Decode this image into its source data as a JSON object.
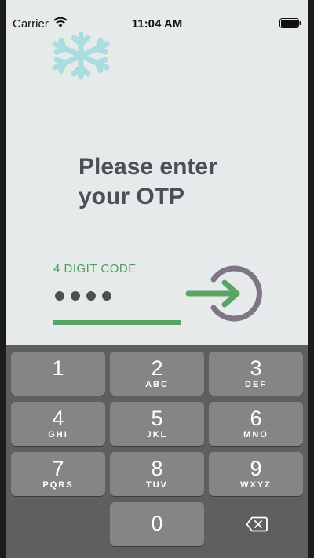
{
  "status_bar": {
    "carrier": "Carrier",
    "time": "11:04 AM"
  },
  "title": {
    "line1": "Please enter",
    "line2": "your OTP"
  },
  "otp": {
    "label": "4 DIGIT CODE",
    "entered_count": 4,
    "max_length": 4
  },
  "colors": {
    "accent_green": "#59a465",
    "title_gray": "#4b4f58",
    "arrow_circle": "#7e7686",
    "background": "#e6eaea"
  },
  "keypad": {
    "keys": [
      {
        "digit": "1",
        "letters": ""
      },
      {
        "digit": "2",
        "letters": "ABC"
      },
      {
        "digit": "3",
        "letters": "DEF"
      },
      {
        "digit": "4",
        "letters": "GHI"
      },
      {
        "digit": "5",
        "letters": "JKL"
      },
      {
        "digit": "6",
        "letters": "MNO"
      },
      {
        "digit": "7",
        "letters": "PQRS"
      },
      {
        "digit": "8",
        "letters": "TUV"
      },
      {
        "digit": "9",
        "letters": "WXYZ"
      },
      {
        "digit": "0",
        "letters": ""
      }
    ],
    "backspace_icon": "backspace-icon"
  },
  "icons": [
    "wifi-icon",
    "battery-icon",
    "snowflake-icon",
    "arrow-right-circle-icon",
    "backspace-icon"
  ]
}
